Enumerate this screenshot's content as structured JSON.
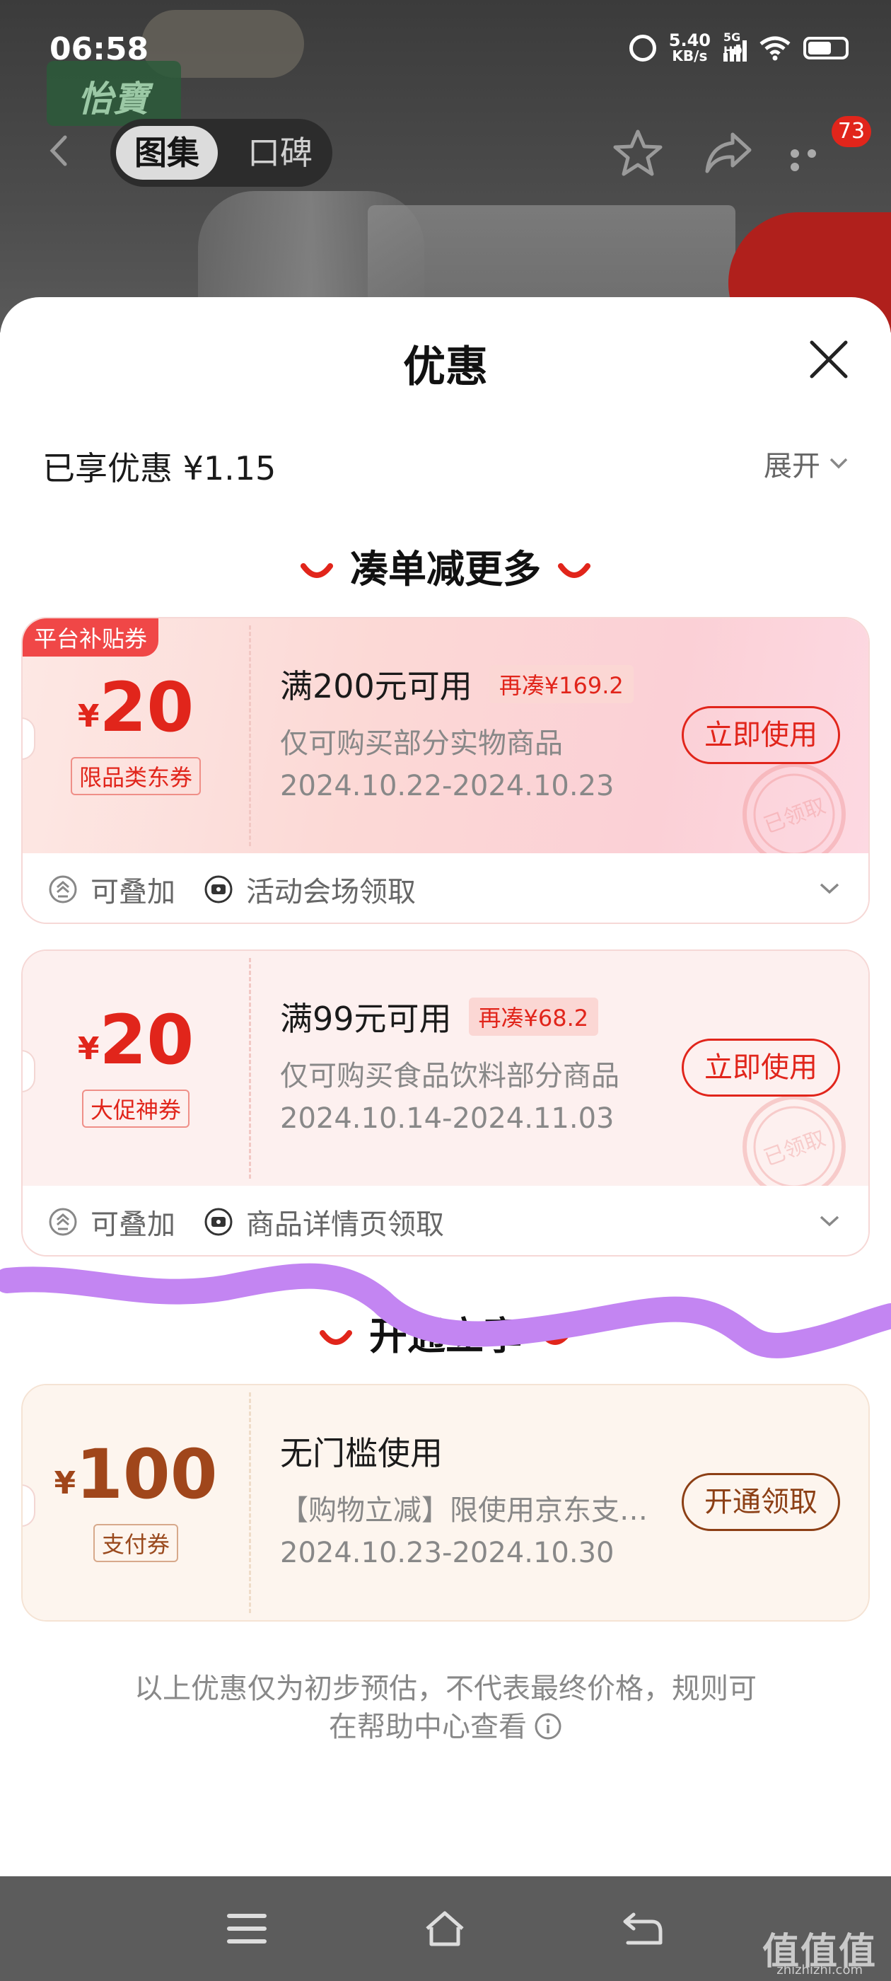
{
  "status_bar": {
    "time": "06:58",
    "net_speed_value": "5.40",
    "net_speed_unit": "KB/s",
    "signal_label": "5G HD"
  },
  "nav": {
    "tabs": [
      {
        "label": "图集",
        "active": true
      },
      {
        "label": "口碑",
        "active": false
      }
    ],
    "message_count": "73"
  },
  "background": {
    "brand_text": "怡寶"
  },
  "sheet": {
    "title": "优惠",
    "enjoyed_label": "已享优惠 ¥1.15",
    "expand_label": "展开",
    "section_more": "凑单减更多",
    "section_open": "开通立享"
  },
  "coupons": [
    {
      "corner_tag": "平台补贴券",
      "currency": "¥",
      "amount": "20",
      "type_label": "限品类东券",
      "condition": "满200元可用",
      "extra": "再凑¥169.2",
      "scope": "仅可购买部分实物商品",
      "dates": "2024.10.22-2024.10.23",
      "button": "立即使用",
      "stamp": "已领取",
      "stackable": "可叠加",
      "source": "活动会场领取"
    },
    {
      "currency": "¥",
      "amount": "20",
      "type_label": "大促神券",
      "condition": "满99元可用",
      "extra": "再凑¥68.2",
      "scope": "仅可购买食品饮料部分商品",
      "dates": "2024.10.14-2024.11.03",
      "button": "立即使用",
      "stamp": "已领取",
      "stackable": "可叠加",
      "source": "商品详情页领取"
    },
    {
      "currency": "¥",
      "amount": "100",
      "type_label": "支付券",
      "condition": "无门槛使用",
      "scope": "【购物立减】限使用京东支…",
      "dates": "2024.10.23-2024.10.30",
      "button": "开通领取"
    }
  ],
  "disclaimer": {
    "line1": "以上优惠仅为初步预估，不代表最终价格，规则可",
    "line2": "在帮助中心查看"
  },
  "watermark": {
    "text": "值值值",
    "sub": "zhizhizhi.com"
  },
  "colors": {
    "accent_red": "#e1251b",
    "gold_brown": "#8c3f15",
    "scribble_purple": "#c084f0"
  }
}
